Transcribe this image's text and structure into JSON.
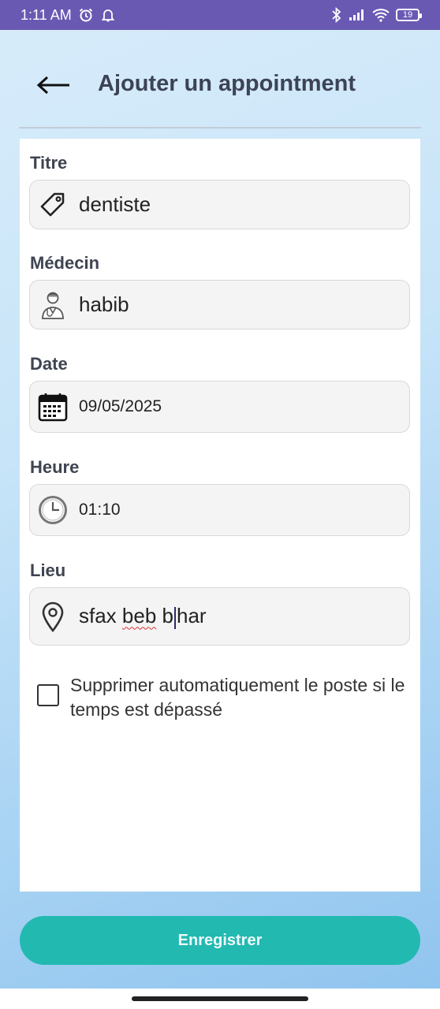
{
  "status_bar": {
    "time": "1:11 AM",
    "battery": "19"
  },
  "header": {
    "title": "Ajouter un appointment"
  },
  "form": {
    "titre": {
      "label": "Titre",
      "value": "dentiste",
      "icon": "tag-icon"
    },
    "medecin": {
      "label": "Médecin",
      "value": "habib",
      "icon": "doctor-icon"
    },
    "date": {
      "label": "Date",
      "value": "09/05/2025",
      "icon": "calendar-icon"
    },
    "heure": {
      "label": "Heure",
      "value": "01:10",
      "icon": "clock-icon"
    },
    "lieu": {
      "label": "Lieu",
      "value_part1": "sfax ",
      "value_spell": "beb",
      "value_part2": " b",
      "value_part3": "har",
      "icon": "location-pin-icon"
    },
    "auto_delete": {
      "label": "Supprimer automatiquement le poste si le temps est dépassé",
      "checked": false
    }
  },
  "actions": {
    "save_label": "Enregistrer"
  },
  "colors": {
    "status_bar": "#6a59b3",
    "accent": "#22b9b0",
    "title": "#3d4356"
  }
}
